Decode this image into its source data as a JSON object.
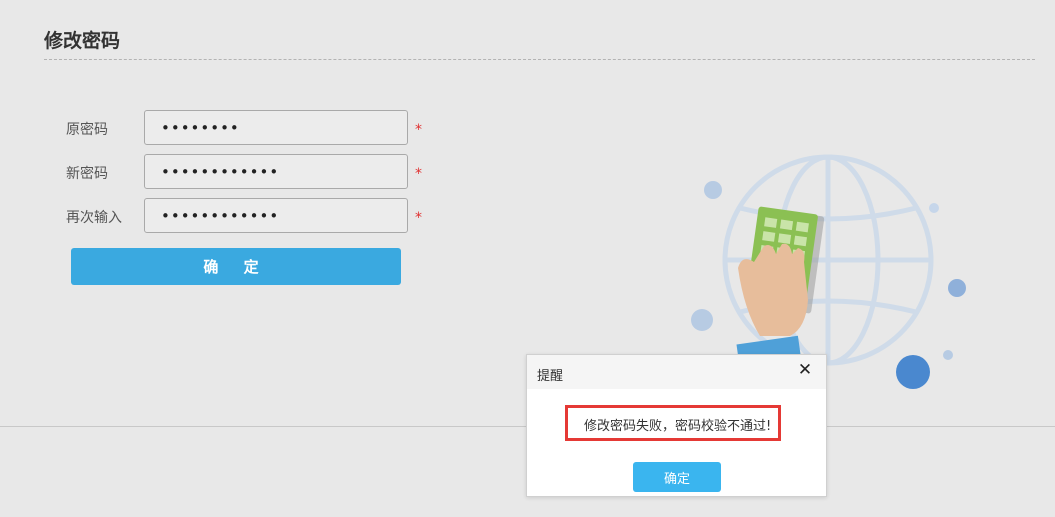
{
  "page": {
    "title": "修改密码"
  },
  "form": {
    "old_password": {
      "label": "原密码",
      "value": "••••••••",
      "required_mark": "*"
    },
    "new_password": {
      "label": "新密码",
      "value": "••••••••••••",
      "required_mark": "*"
    },
    "confirm_password": {
      "label": "再次输入",
      "value": "••••••••••••",
      "required_mark": "*"
    },
    "submit_label": "确 定"
  },
  "illustration": {
    "icon": "globe-hand-calculator-illustration"
  },
  "dialog": {
    "title": "提醒",
    "close_icon": "close-icon",
    "message": "修改密码失败，密码校验不通过!",
    "ok_label": "确定"
  },
  "colors": {
    "primary_button": "#3aa9e0",
    "dialog_button": "#3ab5ef",
    "required_star": "#e03030",
    "highlight_border": "#e53935"
  }
}
